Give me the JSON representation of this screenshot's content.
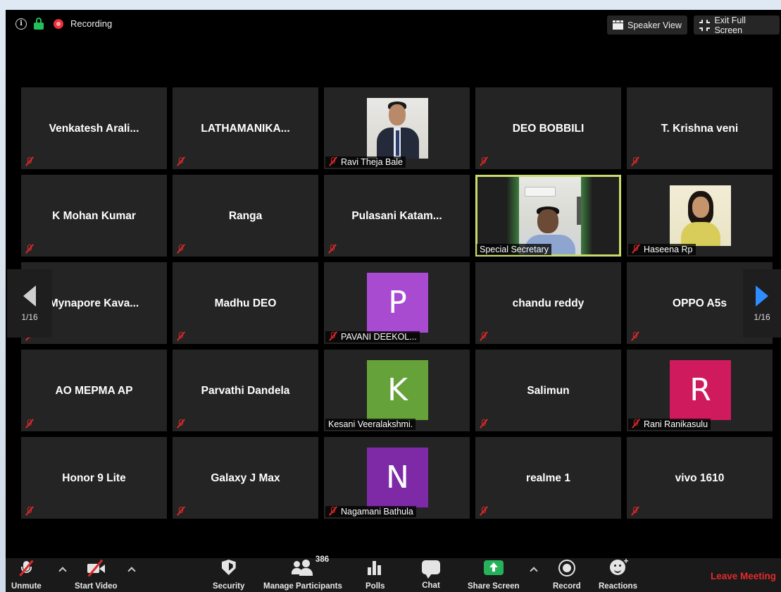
{
  "topbar": {
    "recording_label": "Recording",
    "speaker_view_label": "Speaker View",
    "exit_full_screen_label": "Exit Full Screen"
  },
  "gallery": {
    "page_left": "1/16",
    "page_right": "1/16",
    "tiles": [
      {
        "name": "Venkatesh  Arali..."
      },
      {
        "name": "LATHAMANIKA..."
      },
      {
        "label": "Ravi Theja Bale"
      },
      {
        "name": "DEO BOBBILI"
      },
      {
        "name": "T. Krishna veni"
      },
      {
        "name": "K Mohan Kumar"
      },
      {
        "name": "Ranga"
      },
      {
        "name": "Pulasani  Katam..."
      },
      {
        "label": "Special Secretary"
      },
      {
        "label": "Haseena Rp"
      },
      {
        "name": "Mynapore  Kava..."
      },
      {
        "name": "Madhu DEO"
      },
      {
        "label": "PAVANI DEEKOL...",
        "initial": "P",
        "color": "#a84bd0"
      },
      {
        "name": "chandu reddy"
      },
      {
        "name": "OPPO A5s"
      },
      {
        "name": "AO MEPMA AP"
      },
      {
        "name": "Parvathi Dandela"
      },
      {
        "label": "Kesani Veeralakshmi.",
        "initial": "K",
        "color": "#66a23a"
      },
      {
        "name": "Salimun"
      },
      {
        "label": "Rani Ranikasulu",
        "initial": "R",
        "color": "#cf1a5e"
      },
      {
        "name": "Honor 9 Lite"
      },
      {
        "name": "Galaxy J Max"
      },
      {
        "label": "Nagamani Bathula",
        "initial": "N",
        "color": "#7e2aa7"
      },
      {
        "name": "realme 1"
      },
      {
        "name": "vivo 1610"
      }
    ]
  },
  "toolbar": {
    "unmute": "Unmute",
    "start_video": "Start Video",
    "security": "Security",
    "participants": "Manage Participants",
    "participant_count": "386",
    "polls": "Polls",
    "chat": "Chat",
    "share_screen": "Share Screen",
    "record": "Record",
    "reactions": "Reactions",
    "leave": "Leave Meeting"
  }
}
